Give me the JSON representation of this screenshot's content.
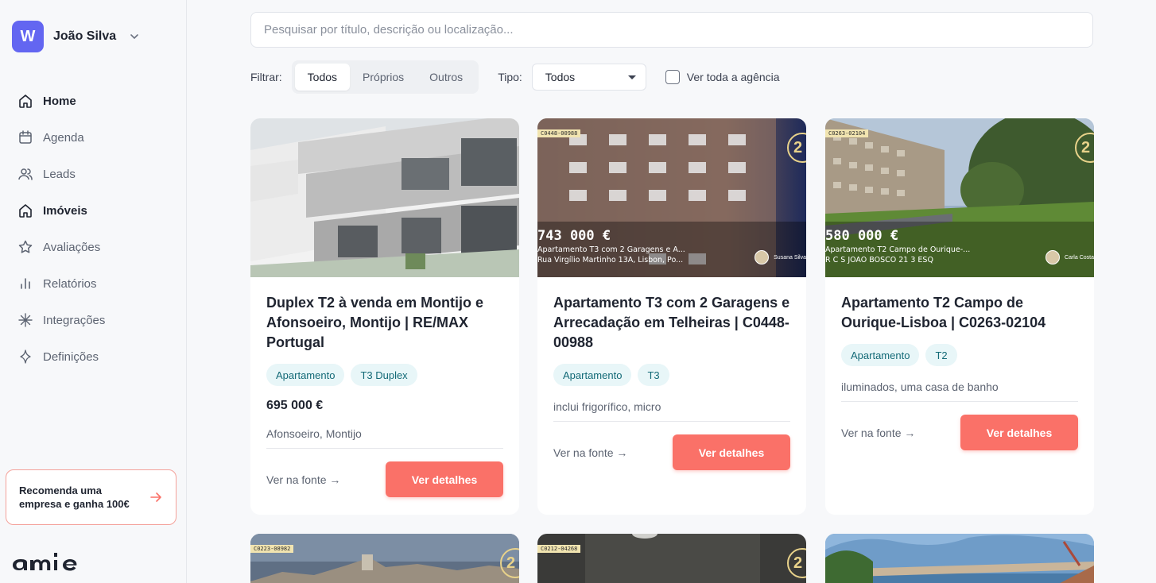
{
  "account": {
    "initial": "W",
    "name": "João Silva"
  },
  "nav": [
    {
      "label": "Home",
      "icon": "home-icon"
    },
    {
      "label": "Agenda",
      "icon": "calendar-icon"
    },
    {
      "label": "Leads",
      "icon": "users-icon"
    },
    {
      "label": "Imóveis",
      "icon": "building-icon"
    },
    {
      "label": "Avaliações",
      "icon": "star-icon"
    },
    {
      "label": "Relatórios",
      "icon": "bar-chart-icon"
    },
    {
      "label": "Integrações",
      "icon": "sparkle-icon"
    },
    {
      "label": "Definições",
      "icon": "settings-icon"
    }
  ],
  "promo": {
    "text": "Recomenda uma empresa e ganha 100€"
  },
  "search": {
    "placeholder": "Pesquisar por título, descrição ou localização..."
  },
  "filters": {
    "label": "Filtrar:",
    "options": [
      "Todos",
      "Próprios",
      "Outros"
    ],
    "tipo_label": "Tipo:",
    "tipo_value": "Todos",
    "agency_label": "Ver toda a agência"
  },
  "colors": {
    "accent": "#fa7168",
    "brand": "#6366f1",
    "tag_bg": "#e8f6f8",
    "tag_text": "#136a77"
  },
  "cards": [
    {
      "title": "Duplex T2 à venda em Montijo e Afonsoeiro, Montijo | RE/MAX Portugal",
      "tags": [
        "Apartamento",
        "T3 Duplex"
      ],
      "price": "695 000 €",
      "desc": "Afonsoeiro, Montijo",
      "link": "Ver na fonte →",
      "button": "Ver detalhes"
    },
    {
      "title": "Apartamento T3 com 2 Garagens e Arrecadação em Telheiras | C0448-00988",
      "tags": [
        "Apartamento",
        "T3"
      ],
      "desc": "inclui frigorífico, micro",
      "link": "Ver na fonte →",
      "button": "Ver detalhes",
      "photo": {
        "code": "C0448-00988",
        "price": "743 000 €",
        "line1": "Apartamento T3 com 2 Garagens e A...",
        "line2": "Rua Virgílio Martinho 13A, Lisbon, Po...",
        "agent": "Susana Silva"
      }
    },
    {
      "title": "Apartamento T2 Campo de Ourique-Lisboa | C0263-02104",
      "tags": [
        "Apartamento",
        "T2"
      ],
      "desc": "iluminados, uma casa de banho",
      "link": "Ver na fonte →",
      "button": "Ver detalhes",
      "photo": {
        "code": "C0263-02104",
        "price": "580 000 €",
        "line1": "Apartamento T2 Campo de Ourique-...",
        "line2": "R C S JOAO BOSCO 21 3 ESQ",
        "agent": "Carla Costa"
      }
    }
  ],
  "row2": [
    {
      "code": "C0223-08982"
    },
    {
      "code": "C0212-04268"
    },
    {}
  ]
}
